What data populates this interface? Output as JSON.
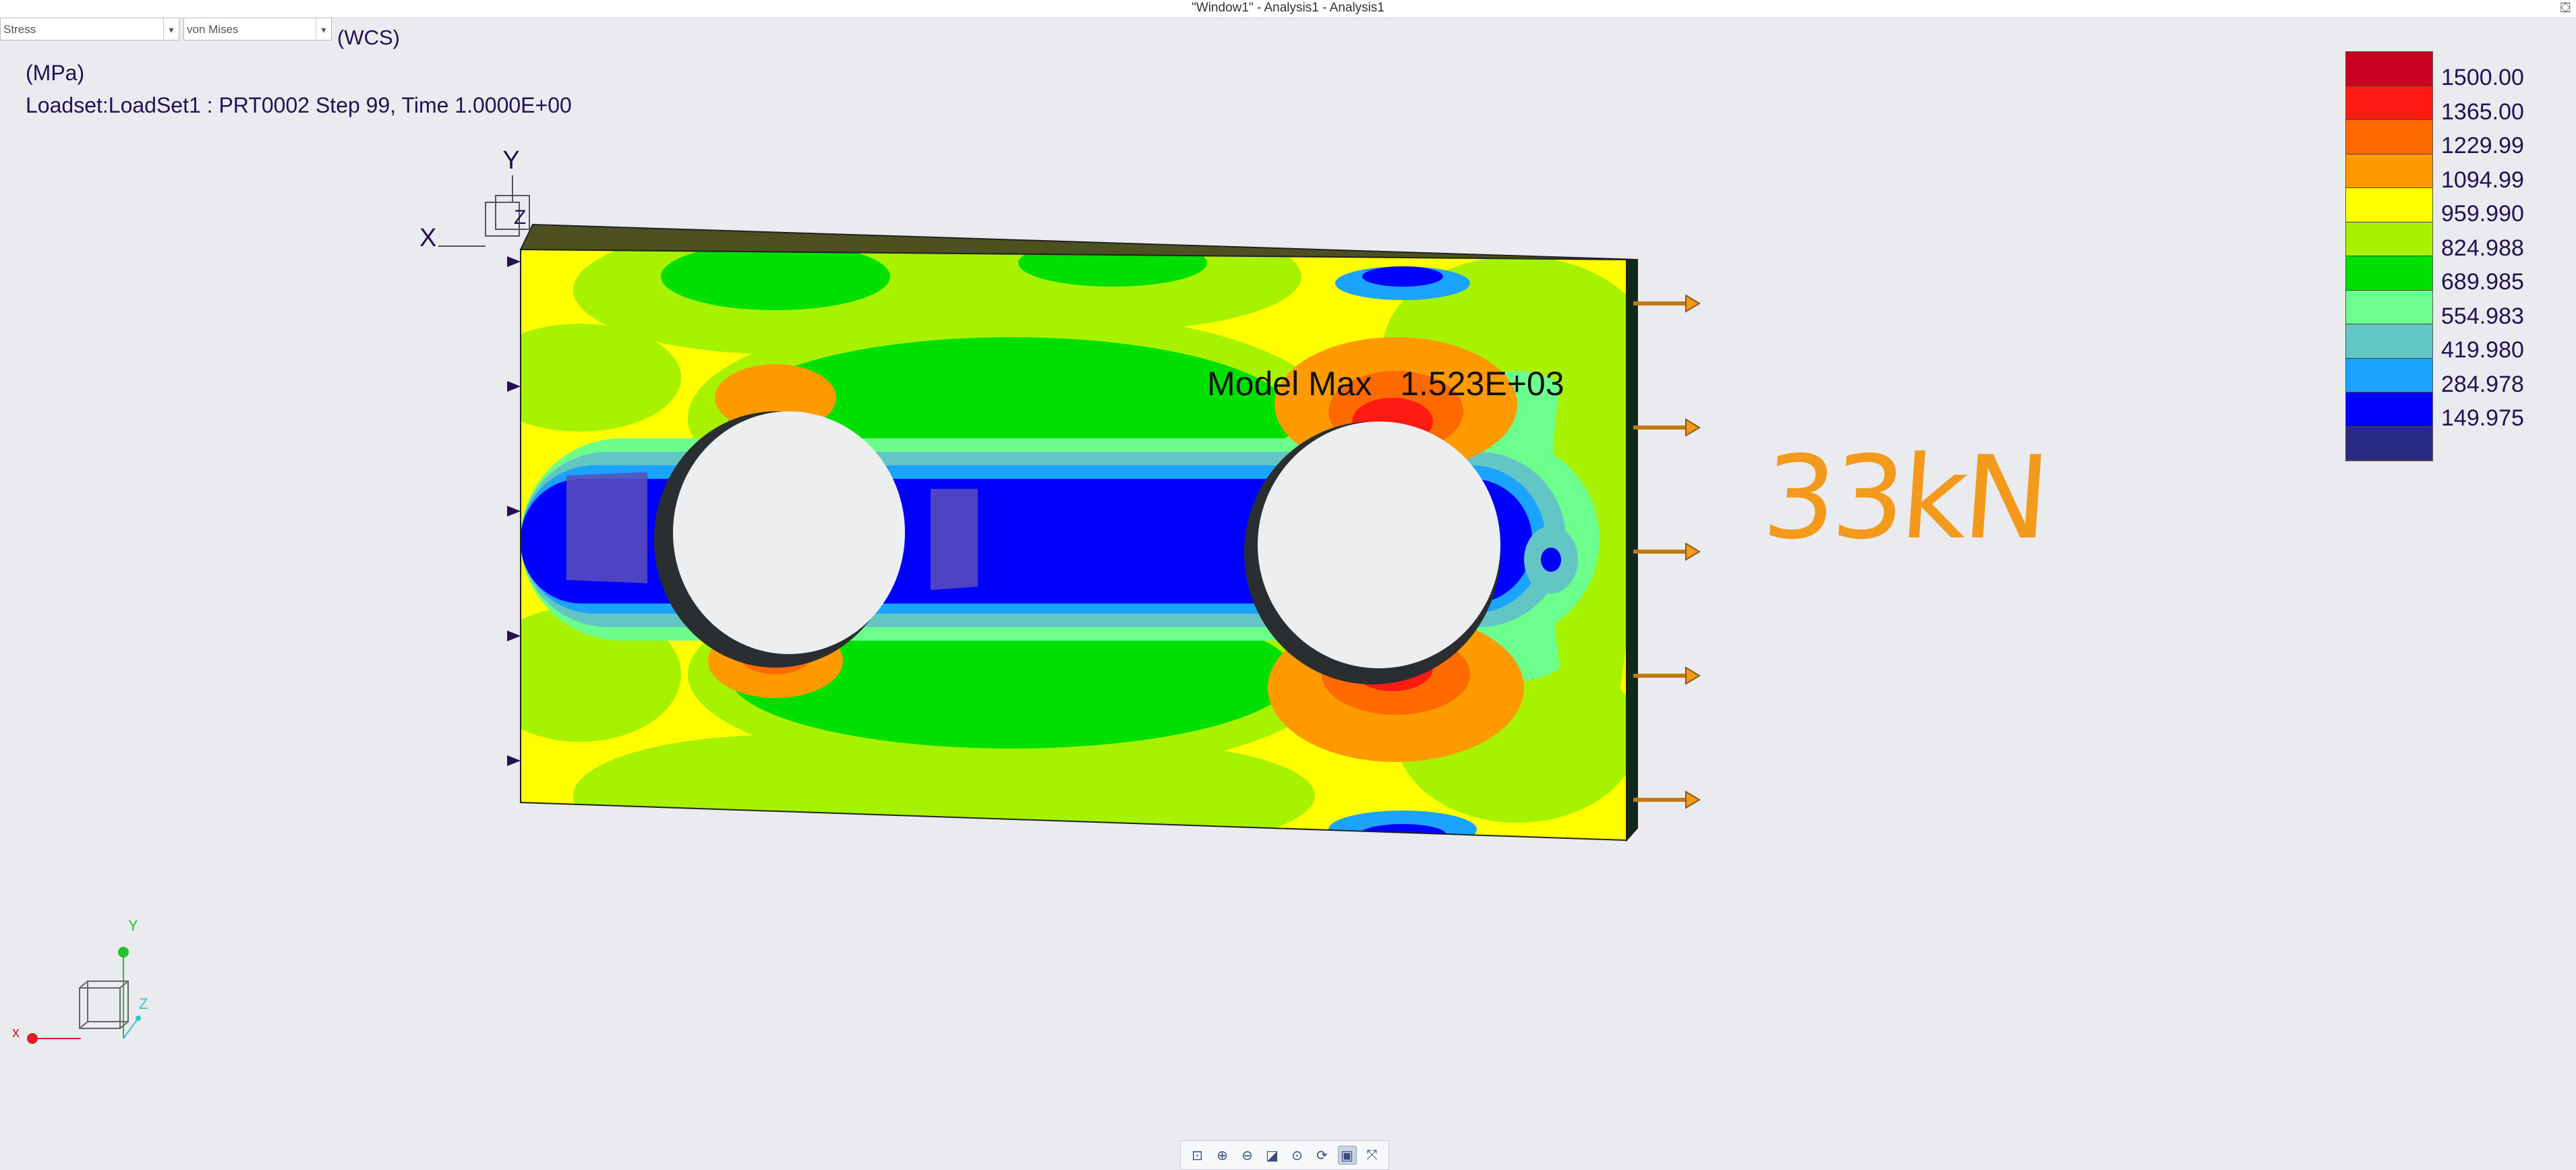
{
  "window": {
    "title": "\"Window1\" - Analysis1 - Analysis1",
    "close_glyph": "⛋"
  },
  "controls": {
    "quantity_select": "Stress",
    "component_select": "von Mises",
    "coord_system": "(WCS)"
  },
  "result_info": {
    "units": "(MPa)",
    "loadset_line": "Loadset:LoadSet1 :  PRT0002 Step 99, Time  1.0000E+00"
  },
  "model_max": {
    "label": "Model Max",
    "value": "1.523E+03"
  },
  "annotation": {
    "text": "33kN",
    "color": "#f39a1c"
  },
  "axis_labels": {
    "x": "X",
    "y": "Y",
    "z": "Z"
  },
  "triad": {
    "x": "x",
    "y": "Y",
    "z": "Z",
    "x_color": "#e11d2a",
    "y_color": "#22c02a",
    "z_color": "#2ec7d3"
  },
  "legend": {
    "colors": [
      "#c8001e",
      "#ff1a12",
      "#ff6a00",
      "#ff9a00",
      "#ffff00",
      "#a6f200",
      "#00e000",
      "#6cff8e",
      "#64c5c5",
      "#1aa3ff",
      "#0000ff",
      "#2a2a82"
    ],
    "values": [
      "1500.00",
      "1365.00",
      "1229.99",
      "1094.99",
      "959.990",
      "824.988",
      "689.985",
      "554.983",
      "419.980",
      "284.978",
      "149.975"
    ]
  },
  "toolbar": {
    "icons": [
      "zoom-fit-icon",
      "zoom-in-icon",
      "zoom-out-icon",
      "zoom-window-icon",
      "refit-icon",
      "spin-icon",
      "view-select-icon",
      "orient-icon"
    ]
  }
}
